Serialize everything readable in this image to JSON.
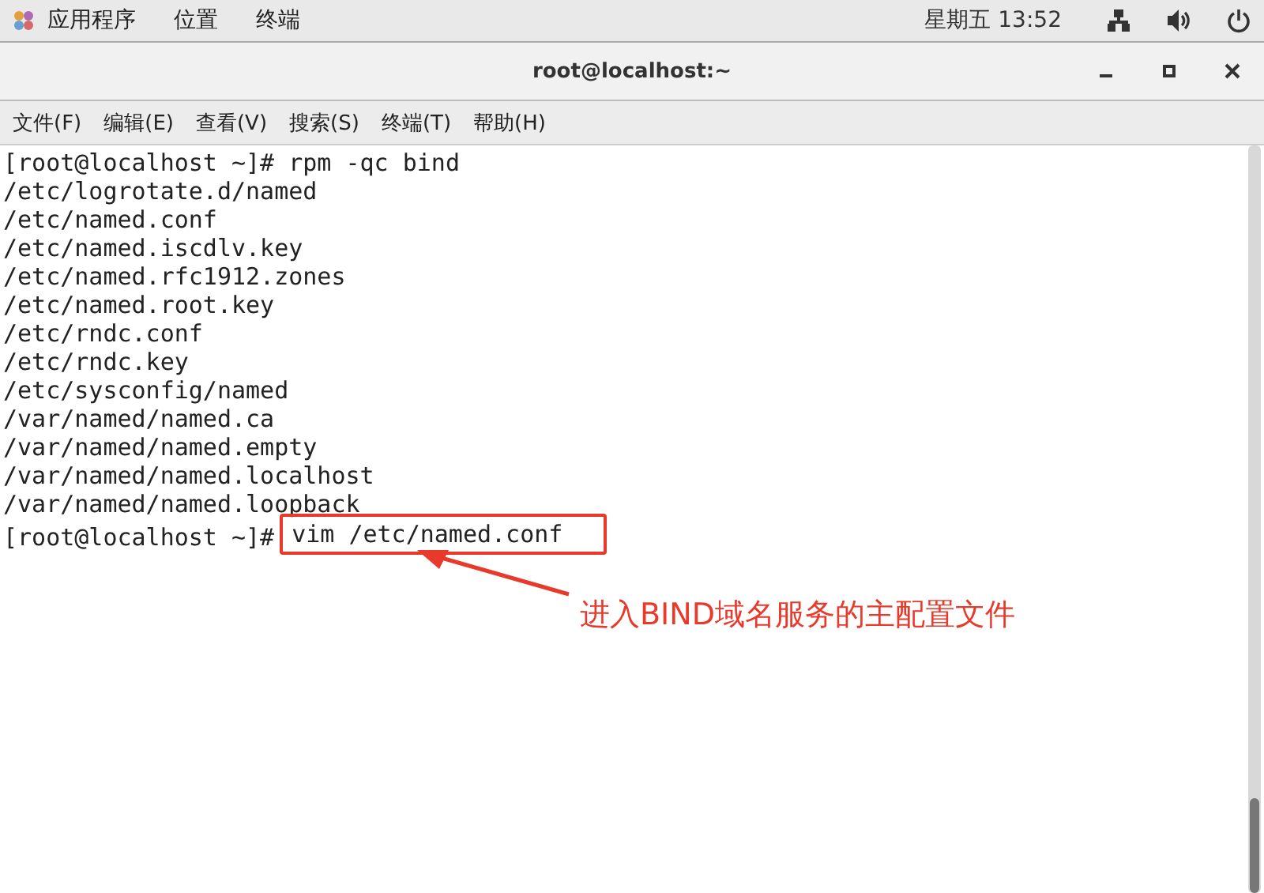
{
  "top_bar": {
    "menus": [
      "应用程序",
      "位置",
      "终端"
    ],
    "clock": "星期五 13:52"
  },
  "window": {
    "title": "root@localhost:~"
  },
  "menu_bar": [
    "文件(F)",
    "编辑(E)",
    "查看(V)",
    "搜索(S)",
    "终端(T)",
    "帮助(H)"
  ],
  "terminal": {
    "lines": [
      "[root@localhost ~]# rpm -qc bind",
      "/etc/logrotate.d/named",
      "/etc/named.conf",
      "/etc/named.iscdlv.key",
      "/etc/named.rfc1912.zones",
      "/etc/named.root.key",
      "/etc/rndc.conf",
      "/etc/rndc.key",
      "/etc/sysconfig/named",
      "/var/named/named.ca",
      "/var/named/named.empty",
      "/var/named/named.localhost",
      "/var/named/named.loopback"
    ],
    "prompt": "[root@localhost ~]#",
    "command": "vim /etc/named.conf"
  },
  "annotation": {
    "text": "进入BIND域名服务的主配置文件"
  }
}
